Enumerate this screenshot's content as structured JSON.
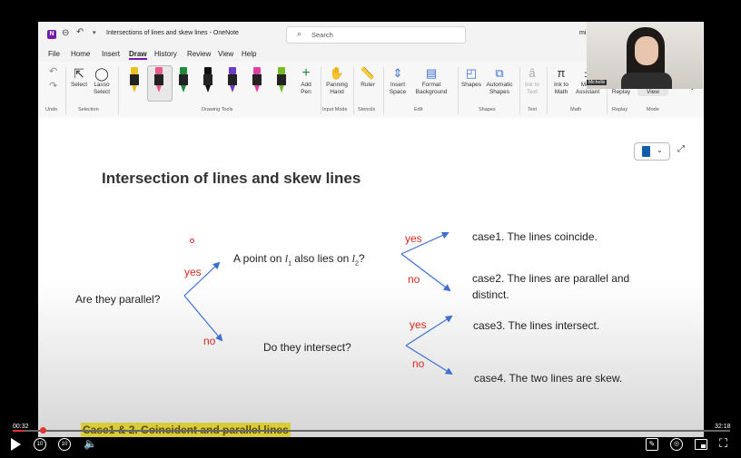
{
  "titlebar": {
    "doc_title": "Intersections of lines and skew lines - OneNote",
    "search_placeholder": "Search",
    "user_short": "mi",
    "webcam_label": "Michelle"
  },
  "menu": [
    "File",
    "Home",
    "Insert",
    "Draw",
    "History",
    "Review",
    "View",
    "Help"
  ],
  "ribbon": {
    "select": "Select",
    "lasso": "Lasso\nSelect",
    "add_pen": "Add\nPen",
    "panning": "Panning\nHand",
    "ruler": "Ruler",
    "insert_space": "Insert\nSpace",
    "format_bg": "Format\nBackground",
    "shapes": "Shapes",
    "auto_shapes": "Automatic\nShapes",
    "ink_to_text": "Ink to\nText",
    "ink_to_math": "Ink to\nMath",
    "math_assist": "Math\nAssistant",
    "ink_replay": "Ink\nReplay",
    "full_page": "Full Page\nView",
    "groups": {
      "undo": "Undo",
      "selection": "Selection",
      "drawing_tools": "Drawing Tools",
      "input_mode": "Input Mode",
      "stencils": "Stencils",
      "edit": "Edit",
      "shapes": "Shapes",
      "text": "Text",
      "math": "Math",
      "replay": "Replay",
      "mode": "Mode"
    },
    "pen_colors": [
      "#e8c020",
      "#e85a8a",
      "#1e8a3a",
      "#111111",
      "#6a3cc8",
      "#e040a0",
      "#78b82a"
    ]
  },
  "note": {
    "title": "Intersection of lines and skew lines",
    "question1": "Are they parallel?",
    "yes": "yes",
    "no": "no",
    "question2_pre": "A point on ",
    "question2_l1": "l",
    "question2_mid": " also lies on ",
    "question2_l2": "l",
    "question2_end": "?",
    "sub1": "1",
    "sub2": "2",
    "question3": "Do they intersect?",
    "case1": "case1. The lines coincide.",
    "case2a": "case2. The lines are parallel and",
    "case2b": "distinct.",
    "case3": "case3. The lines intersect.",
    "case4": "case4. The two lines are skew.",
    "heading2": "Case1 & 2. Coincident and parallel lines"
  },
  "player": {
    "current_time": "00:32",
    "total_time": "32:18",
    "skip_back": "10",
    "skip_fwd": "10",
    "progress": 0.017
  },
  "colors": {
    "arrow": "#3d6fd1",
    "red": "#d42a1e",
    "highlight": "#d8cc3a",
    "onenote": "#7719aa"
  }
}
